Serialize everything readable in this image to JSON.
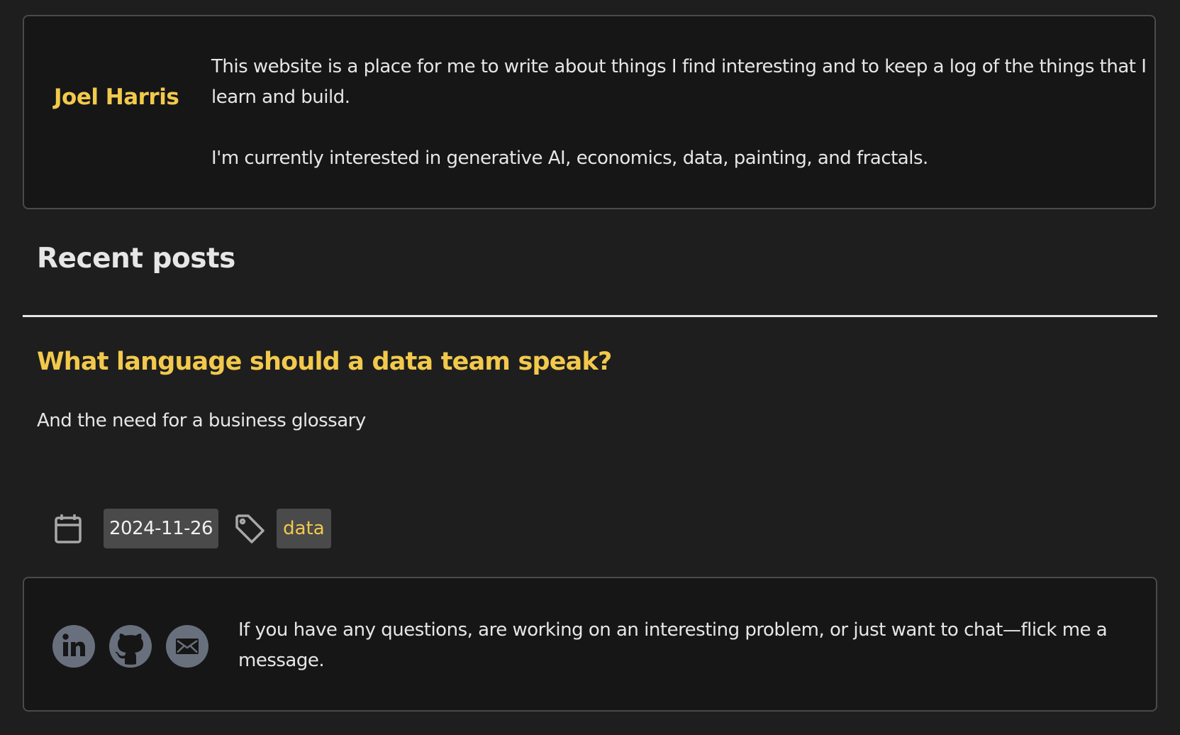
{
  "intro": {
    "author_name": "Joel Harris",
    "paragraph_1": "This website is a place for me to write about things I find interesting and to keep a log of the things that I learn and build.",
    "paragraph_2": "I'm currently interested in generative AI, economics, data, painting, and fractals."
  },
  "recent_posts": {
    "heading": "Recent posts",
    "posts": [
      {
        "title": "What language should a data team speak?",
        "subtitle": "And the need for a business glossary",
        "date": "2024-11-26",
        "tag": "data"
      }
    ]
  },
  "contact": {
    "message": "If you have any questions, are working on an interesting problem, or just want to chat—flick me a message.",
    "icons": [
      "linkedin-icon",
      "github-icon",
      "email-icon"
    ]
  },
  "colors": {
    "background": "#1e1e1e",
    "card_background": "#161616",
    "accent": "#f2c94c",
    "badge_background": "#4a4a4a",
    "social_icon": "#69707d"
  }
}
